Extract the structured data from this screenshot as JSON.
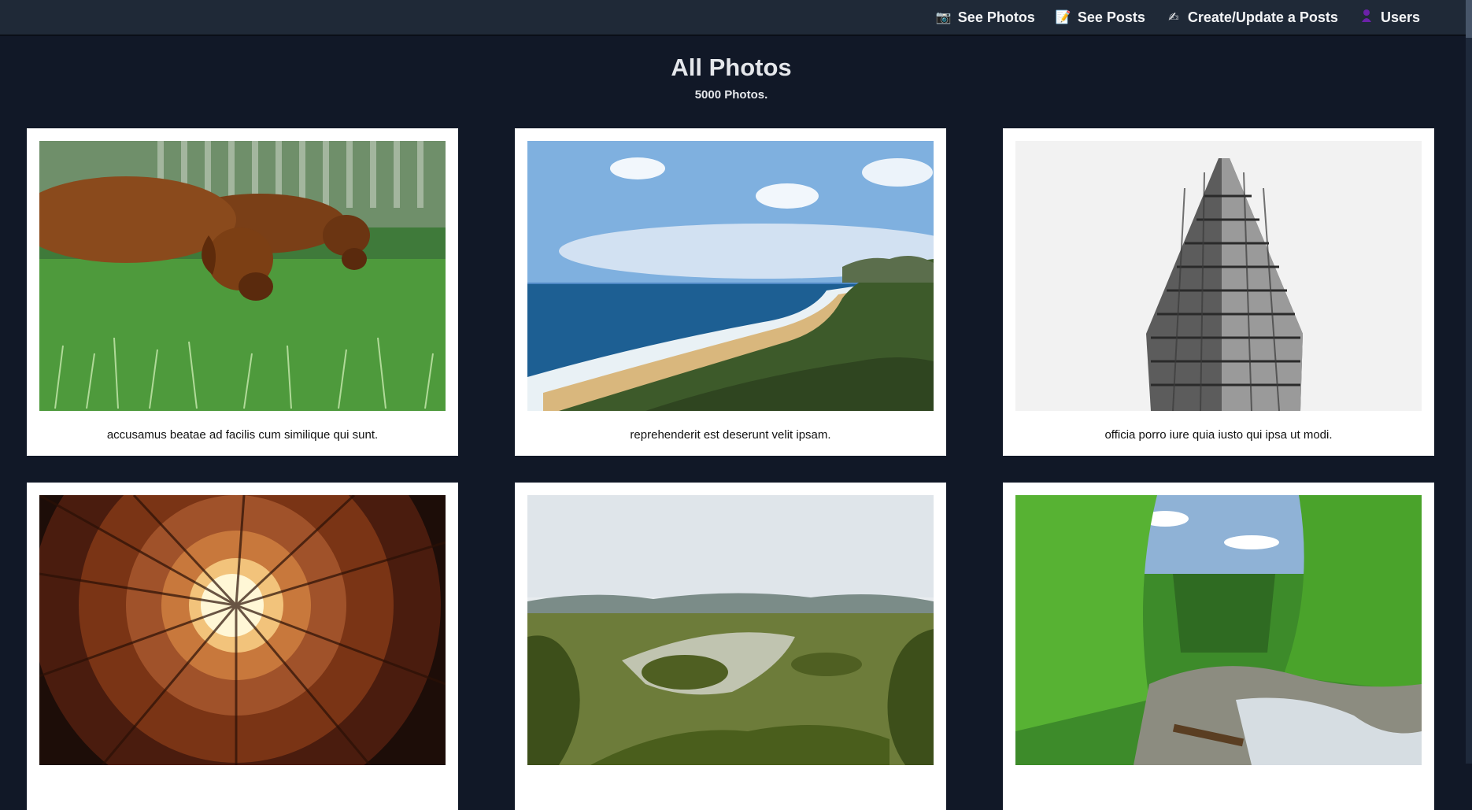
{
  "nav": {
    "items": [
      {
        "label": "See Photos",
        "icon": "camera-icon"
      },
      {
        "label": "See Posts",
        "icon": "memo-icon"
      },
      {
        "label": "Create/Update a Posts",
        "icon": "writing-hand-icon"
      },
      {
        "label": "Users",
        "icon": "person-icon"
      }
    ]
  },
  "header": {
    "title": "All Photos",
    "count_text": "5000 Photos."
  },
  "photos": [
    {
      "caption": "accusamus beatae ad facilis cum similique qui sunt.",
      "subject": "dogs-on-grass"
    },
    {
      "caption": "reprehenderit est deserunt velit ipsam.",
      "subject": "coastline"
    },
    {
      "caption": "officia porro iure quia iusto qui ipsa ut modi.",
      "subject": "flatiron-building"
    },
    {
      "caption": "",
      "subject": "courtyard-looking-up"
    },
    {
      "caption": "",
      "subject": "jungle-lake"
    },
    {
      "caption": "",
      "subject": "forest-stream"
    }
  ],
  "colors": {
    "page_bg": "#111827",
    "topbar_bg": "#1f2937",
    "card_bg": "#ffffff"
  }
}
